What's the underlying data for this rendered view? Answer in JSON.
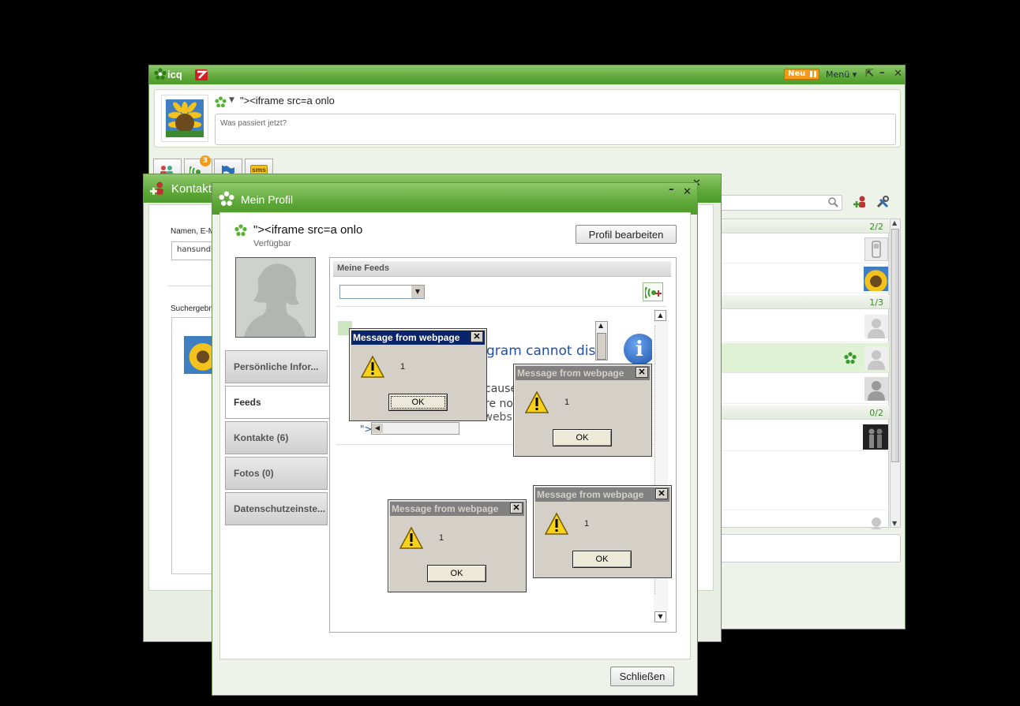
{
  "main_window": {
    "brand": "icq",
    "new_badge": "Neu",
    "menu_label": "Menü ▾",
    "status_name": "\"><iframe src=a onlo",
    "status_placeholder": "Was passiert jetzt?",
    "notification_count": "3",
    "sms_label": "sms",
    "group_counts": [
      "2/2",
      "1/3",
      "0/2"
    ]
  },
  "contacts_window": {
    "title": "Kontakte",
    "search_label": "Namen, E-M",
    "search_value": "hansundh",
    "results_label": "Suchergebn"
  },
  "profile_window": {
    "title": "Mein Profil",
    "name": "\"><iframe src=a onlo",
    "status": "Verfügbar",
    "edit_button": "Profil bearbeiten",
    "feeds_header": "Meine Feeds",
    "tabs": [
      "Persönliche Infor...",
      "Feeds",
      "Kontakte (6)",
      "Fotos (0)",
      "Datenschutzeinste..."
    ],
    "close_button": "Schließen",
    "embedded_heading": "gram cannot dis",
    "embedded_lines": [
      "cause",
      "re no",
      "The website"
    ],
    "embedded_link": "\">"
  },
  "dialogs": [
    {
      "title": "Message from webpage",
      "message": "1",
      "ok_label": "OK"
    },
    {
      "title": "Message from webpage",
      "message": "1",
      "ok_label": "OK"
    },
    {
      "title": "Message from webpage",
      "message": "1",
      "ok_label": "OK"
    },
    {
      "title": "Message from webpage",
      "message": "1",
      "ok_label": "OK"
    }
  ],
  "colors": {
    "icq_green": "#5fa83a",
    "dialog_active_title": "#0a246a",
    "dialog_inactive_title": "#808080",
    "dialog_face": "#d4d0c8"
  }
}
